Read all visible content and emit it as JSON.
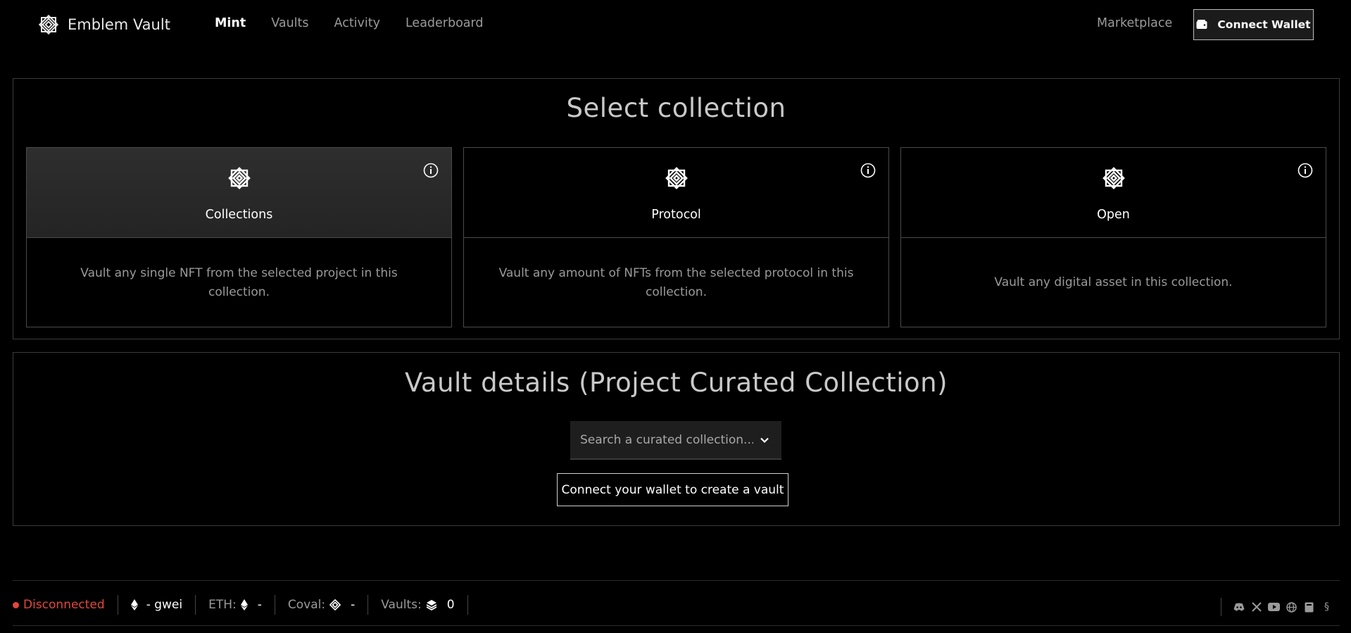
{
  "header": {
    "logo_text": "Emblem Vault",
    "nav": [
      {
        "label": "Mint",
        "active": true
      },
      {
        "label": "Vaults",
        "active": false
      },
      {
        "label": "Activity",
        "active": false
      },
      {
        "label": "Leaderboard",
        "active": false
      }
    ],
    "marketplace_label": "Marketplace",
    "connect_wallet_label": "Connect Wallet"
  },
  "select_collection": {
    "title": "Select collection",
    "cards": [
      {
        "label": "Collections",
        "description": "Vault any single NFT from the selected project in this collection.",
        "selected": true,
        "icon": "emblem-icon"
      },
      {
        "label": "Protocol",
        "description": "Vault any amount of NFTs from the selected protocol in this collection.",
        "selected": false,
        "icon": "emblem-icon"
      },
      {
        "label": "Open",
        "description": "Vault any digital asset in this collection.",
        "selected": false,
        "icon": "emblem-icon"
      }
    ]
  },
  "vault_details": {
    "title": "Vault details (Project Curated Collection)",
    "search_placeholder": "Search a curated collection...",
    "create_button_label": "Connect your wallet to create a vault"
  },
  "footer": {
    "status": "Disconnected",
    "gas_value": "- gwei",
    "eth_label": "ETH:",
    "eth_value": "-",
    "coval_label": "Coval:",
    "coval_value": "-",
    "vaults_label": "Vaults:",
    "vaults_value": "0",
    "social_icons": [
      "discord-icon",
      "x-icon",
      "youtube-icon",
      "globe-icon",
      "book-icon",
      "section-icon"
    ]
  },
  "colors": {
    "background": "#000000",
    "status_disconnected": "#e2473e",
    "selected_card": "#2a2a2a"
  }
}
